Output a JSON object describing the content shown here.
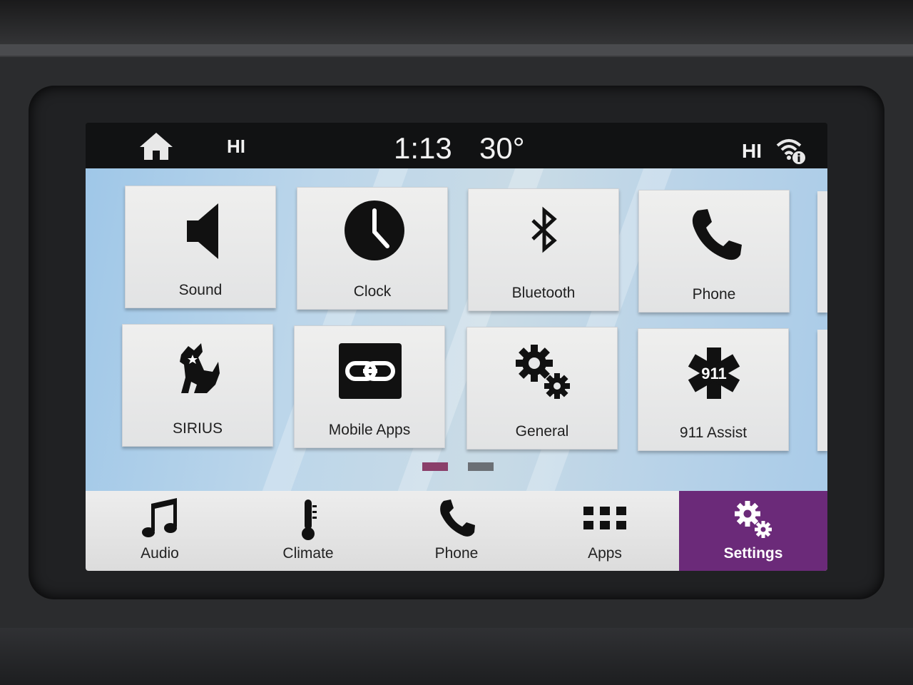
{
  "status_bar": {
    "left_label": "HI",
    "time": "1:13",
    "temperature": "30°",
    "right_label": "HI"
  },
  "tiles": [
    {
      "label": "Sound",
      "icon": "speaker-icon"
    },
    {
      "label": "Clock",
      "icon": "clock-icon"
    },
    {
      "label": "Bluetooth",
      "icon": "bluetooth-icon"
    },
    {
      "label": "Phone",
      "icon": "phone-icon"
    },
    {
      "label": "SIRIUS",
      "icon": "sirius-dog-icon"
    },
    {
      "label": "Mobile Apps",
      "icon": "link-icon"
    },
    {
      "label": "General",
      "icon": "gears-icon"
    },
    {
      "label": "911 Assist",
      "icon": "star-of-life-icon",
      "icon_text": "911"
    }
  ],
  "pager": {
    "current_page": 1,
    "page_count": 2,
    "active_color": "#8a3f6a",
    "inactive_color": "#6b6f75"
  },
  "nav": [
    {
      "label": "Audio",
      "icon": "music-note-icon"
    },
    {
      "label": "Climate",
      "icon": "thermometer-icon"
    },
    {
      "label": "Phone",
      "icon": "phone-icon"
    },
    {
      "label": "Apps",
      "icon": "grid-icon"
    },
    {
      "label": "Settings",
      "icon": "gears-icon",
      "active": true
    }
  ],
  "colors": {
    "accent": "#6b2a79",
    "icon": "#111111"
  }
}
